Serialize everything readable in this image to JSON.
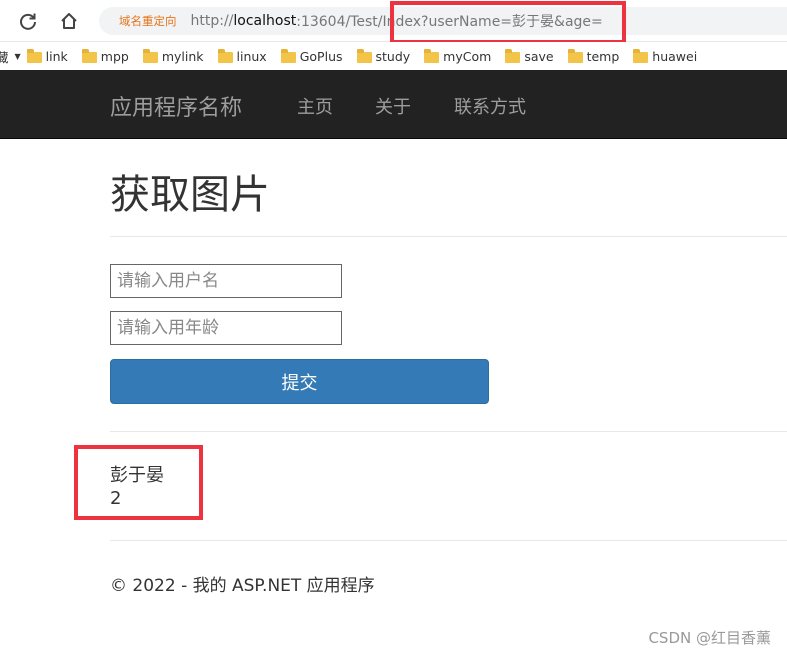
{
  "browser": {
    "redirect_label": "域名重定向",
    "url_protocol": "http://",
    "url_host": "localhost",
    "url_rest": ":13604/Test/Index?userName=彭于晏&age="
  },
  "bookmarks": {
    "lead": "藏",
    "items": [
      "link",
      "mpp",
      "mylink",
      "linux",
      "GoPlus",
      "study",
      "myCom",
      "save",
      "temp",
      "huawei"
    ]
  },
  "navbar": {
    "brand": "应用程序名称",
    "links": [
      "主页",
      "关于",
      "联系方式"
    ]
  },
  "main": {
    "title": "获取图片",
    "username_placeholder": "请输入用户名",
    "age_placeholder": "请输入用年龄",
    "submit_label": "提交",
    "result_name": "彭于晏",
    "result_age": "2"
  },
  "footer": {
    "text": "© 2022 - 我的 ASP.NET 应用程序"
  },
  "watermark": "CSDN @红目香薰",
  "colors": {
    "navbar_bg": "#222222",
    "primary_button": "#337ab7",
    "highlight_border": "#ee3340",
    "redirect_text": "#e8731a"
  }
}
